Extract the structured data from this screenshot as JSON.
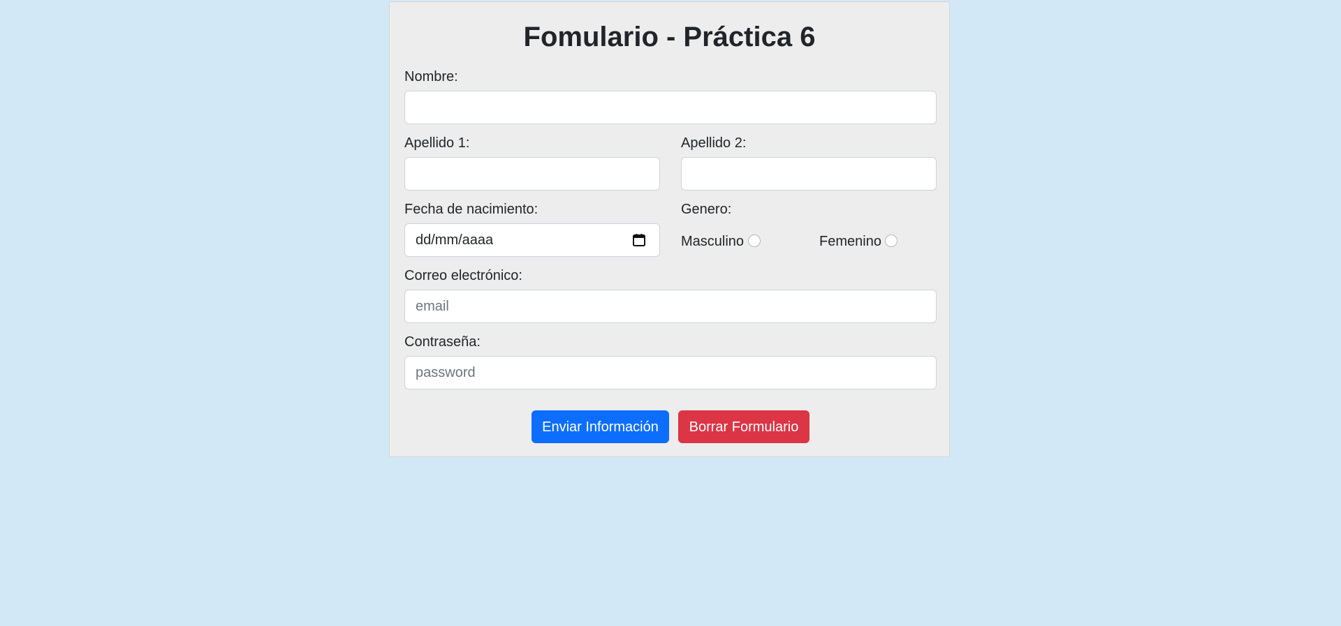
{
  "form": {
    "title": "Fomulario - Práctica 6",
    "nombre": {
      "label": "Nombre:",
      "value": ""
    },
    "apellido1": {
      "label": "Apellido 1:",
      "value": ""
    },
    "apellido2": {
      "label": "Apellido 2:",
      "value": ""
    },
    "fecha": {
      "label": "Fecha de nacimiento:",
      "placeholder": "dd/mm/aaaa"
    },
    "genero": {
      "label": "Genero:",
      "options": [
        {
          "label": "Masculino",
          "checked": false
        },
        {
          "label": "Femenino",
          "checked": false
        }
      ]
    },
    "correo": {
      "label": "Correo electrónico:",
      "placeholder": "email"
    },
    "password": {
      "label": "Contraseña:",
      "placeholder": "password"
    },
    "buttons": {
      "submit_label": "Enviar Información",
      "reset_label": "Borrar Formulario"
    }
  },
  "colors": {
    "background": "#d2e8f7",
    "card": "#ededed",
    "primary": "#0d6efd",
    "danger": "#dc3545"
  },
  "icons": {
    "calendar": "calendar-icon"
  }
}
